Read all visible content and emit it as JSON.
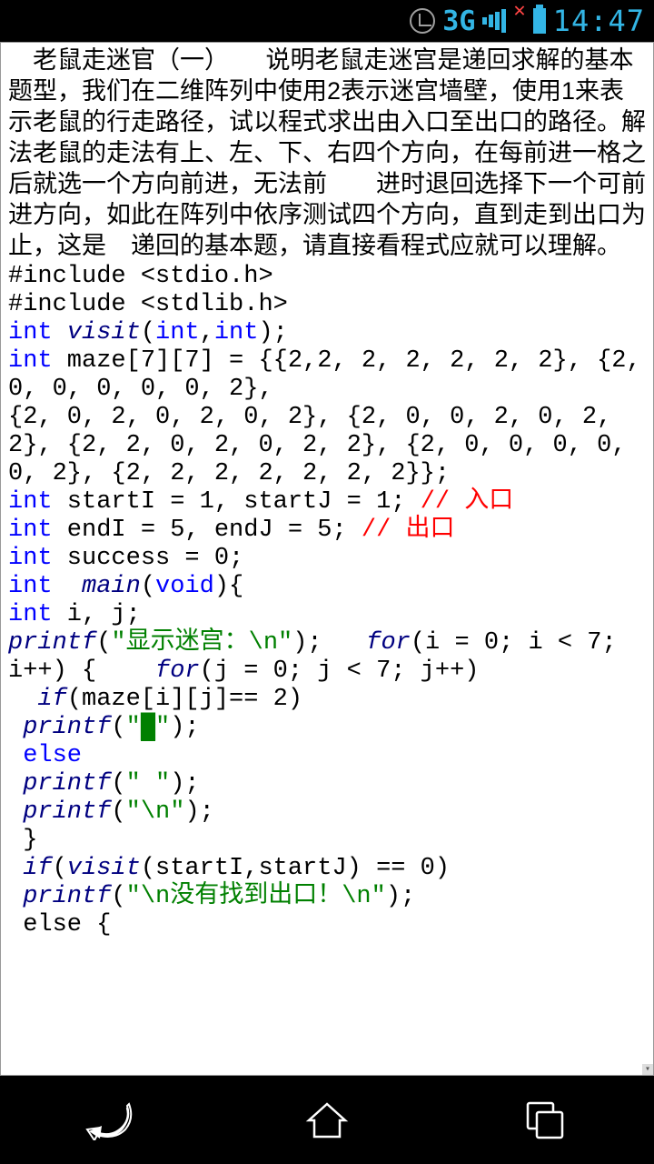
{
  "status": {
    "network": "3G",
    "time": "14:47"
  },
  "doc": {
    "description": "　老鼠走迷官（一）　　说明老鼠走迷宫是递回求解的基本题型，我们在二维阵列中使用2表示迷宫墙壁，使用1来表示老鼠的行走路径，试以程式求出由入口至出口的路径。解法老鼠的走法有上、左、下、右四个方向，在每前进一格之后就选一个方向前进，无法前　　进时退回选择下一个可前进方向，如此在阵列中依序测试四个方向，直到走到出口为止，这是　递回的基本题，请直接看程式应就可以理解。",
    "l1a": "#include <stdio.h>",
    "l1b": "#include <stdlib.h>",
    "int": "int",
    "visit": "visit",
    "l2b": "(",
    "l2c": ",",
    "l2d": ");",
    "l3": " maze[7][7] = {{2,2, 2, 2, 2, 2, 2}, {2, 0, 0, 0, 0, 0, 2},",
    "l4": "{2, 0, 2, 0, 2, 0, 2}, {2, 0, 0, 2, 0, 2, 2}, {2, 2, 0, 2, 0, 2, 2}, {2, 0, 0, 0, 0, 0, 2}, {2, 2, 2, 2, 2, 2, 2}};",
    "l5a": " startI = 1, startJ = 1; ",
    "c5": "// 入口",
    "l6a": " endI = 5, endJ = 5; ",
    "c6": "// 出口",
    "l7": " success = 0;",
    "main": "main",
    "l8b": "(",
    "void": "void",
    "l8c": "){",
    "l9": " i, j;",
    "printf": "printf",
    "l10b": "(",
    "s10": "\"显示迷宫：\\n\"",
    "l10c": ");   ",
    "for": "for",
    "l10e": "(i = 0; i < 7; i++) {    ",
    "l10g": "(j = 0; j < 7; j++)",
    "if": "if",
    "l11b": "(maze[i][j]== 2)",
    "l12b": "(",
    "s12a": "\"",
    "blk": "█",
    "s12b": "\"",
    "l12c": ");",
    "else": "else",
    "l14b": "(",
    "s14": "\" \"",
    "l14c": ");",
    "l15b": "(",
    "s15": "\"\\n\"",
    "l15c": ");",
    "l16": " }",
    "l17b": "(",
    "l17d": "(startI,startJ) == 0)",
    "l18b": "(",
    "s18": "\"\\n没有找到出口！\\n\"",
    "l18c": ");",
    "l19": " else {"
  }
}
